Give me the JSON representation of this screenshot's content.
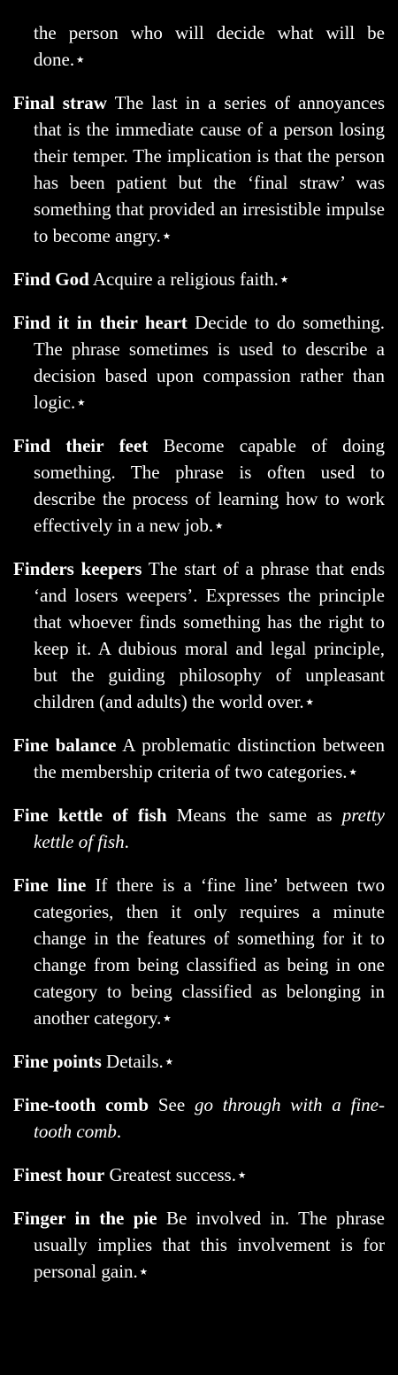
{
  "entries": [
    {
      "term": "",
      "definition": "the person who will decide what will be done.⋆"
    },
    {
      "term": "Final straw",
      "definition": " The last in a series of annoyances that is the immediate cause of a person losing their temper. The implication is that the person has been patient but the ‘final straw’ was something that provided an irresistible impulse to become angry.⋆"
    },
    {
      "term": "Find God",
      "definition": " Acquire a religious faith.⋆"
    },
    {
      "term": "Find it in their heart",
      "definition": " Decide to do something. The phrase sometimes is used to describe a decision based upon compassion rather than logic.⋆"
    },
    {
      "term": "Find their feet",
      "definition": " Become capable of doing something. The phrase is often used to describe the process of learning how to work effectively in a new job.⋆"
    },
    {
      "term": "Finders keepers",
      "definition": " The start of a phrase that ends ‘and losers weepers’. Expresses the principle that whoever finds something has the right to keep it. A dubious moral and legal principle, but the guiding philosophy of unpleasant children (and adults) the world over.⋆"
    },
    {
      "term": "Fine balance",
      "definition": " A problematic distinction between the membership criteria of two categories.⋆"
    },
    {
      "term": "Fine kettle of fish",
      "definition": " Means the same as ",
      "ref": "pretty kettle of fish",
      "after": "."
    },
    {
      "term": "Fine line",
      "definition": " If there is a ‘fine line’ between two categories, then it only requires a minute change in the features of something for it to change from being classified as being in one category to being classified as belonging in another category.⋆"
    },
    {
      "term": "Fine points",
      "definition": " Details.⋆"
    },
    {
      "term": "Fine-tooth comb",
      "definition": " See ",
      "ref": "go through with a fine-tooth comb",
      "after": "."
    },
    {
      "term": "Finest hour",
      "definition": " Greatest success.⋆"
    },
    {
      "term": "Finger in the pie",
      "definition": " Be involved in. The phrase usually implies that this involvement is for personal gain.⋆"
    }
  ]
}
